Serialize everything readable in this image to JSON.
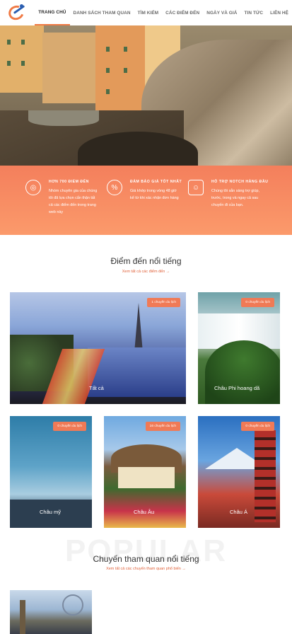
{
  "nav": {
    "items": [
      {
        "label": "TRANG CHỦ",
        "active": true
      },
      {
        "label": "DANH SÁCH THAM QUAN",
        "active": false
      },
      {
        "label": "TÌM KIẾM",
        "active": false
      },
      {
        "label": "CÁC ĐIỂM ĐẾN",
        "active": false
      },
      {
        "label": "NGÀY VÀ GIÁ",
        "active": false
      },
      {
        "label": "TIN TỨC",
        "active": false
      },
      {
        "label": "LIÊN HỆ",
        "active": false
      }
    ]
  },
  "features": [
    {
      "icon": "globe-icon",
      "title": "HƠN 700 ĐIỂM ĐẾN",
      "text": "Nhóm chuyên gia của chúng tôi đã lựa chọn cẩn thận tất cả các điểm đến trong trang web này"
    },
    {
      "icon": "percent-icon",
      "title": "ĐẢM BẢO GIÁ TỐT NHẤT",
      "text": "Giá khớp trong vòng 48 giờ kể từ khi xác nhận đơn hàng"
    },
    {
      "icon": "support-icon",
      "title": "HỖ TRỢ NOTCH HÀNG ĐẦU",
      "text": "Chúng tôi sẵn sàng trợ giúp, trước, trong và ngay cả sau chuyến đi của bạn."
    }
  ],
  "destinations": {
    "title": "Điểm đến nổi tiếng",
    "link": "Xem tất cả các điểm đến →",
    "cards": [
      {
        "name": "Tất cả",
        "badge": "1 chuyến du lịch"
      },
      {
        "name": "Châu Phi hoang dã",
        "badge": "0 chuyến du lịch"
      },
      {
        "name": "Châu mỹ",
        "badge": "0 chuyến du lịch"
      },
      {
        "name": "Châu Âu",
        "badge": "16 chuyến du lịch"
      },
      {
        "name": "Châu Á",
        "badge": "0 chuyến du lịch"
      }
    ]
  },
  "tours": {
    "bg_word": "POPULAR",
    "title": "Chuyến tham quan nổi tiếng",
    "link": "Xem tất cả các chuyến tham quan phổ biến →"
  },
  "colors": {
    "accent": "#f07a45",
    "brand_blue": "#2a5db0"
  }
}
